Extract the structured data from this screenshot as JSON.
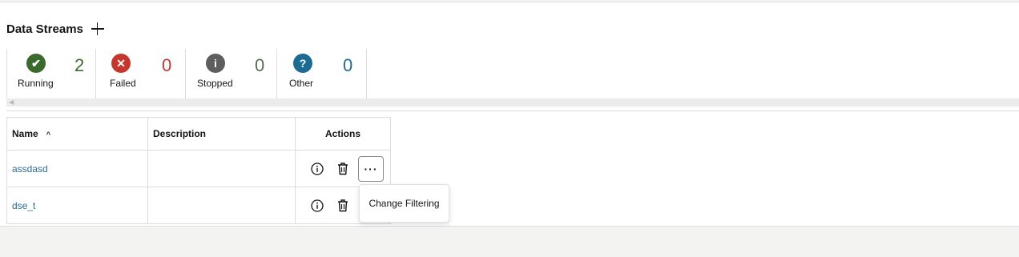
{
  "header": {
    "title": "Data Streams",
    "add_icon": "plus-icon"
  },
  "status": [
    {
      "label": "Running",
      "count": "2",
      "icon": "check-circle-icon",
      "glyph": "✔",
      "color": "#3a6b2d",
      "count_color": "#3a6b2d"
    },
    {
      "label": "Failed",
      "count": "0",
      "icon": "x-circle-icon",
      "glyph": "✕",
      "color": "#c5362c",
      "count_color": "#c5362c"
    },
    {
      "label": "Stopped",
      "count": "0",
      "icon": "info-circle-icon",
      "glyph": "i",
      "color": "#5e5e5e",
      "count_color": "#5a6a5a"
    },
    {
      "label": "Other",
      "count": "0",
      "icon": "question-circle-icon",
      "glyph": "?",
      "color": "#1c6b93",
      "count_color": "#1c6b93"
    }
  ],
  "table": {
    "columns": [
      "Name",
      "Description",
      "Actions"
    ],
    "rows": [
      {
        "name": "assdasd",
        "description": ""
      },
      {
        "name": "dse_t",
        "description": ""
      }
    ]
  },
  "popup": {
    "label": "Change Filtering"
  }
}
